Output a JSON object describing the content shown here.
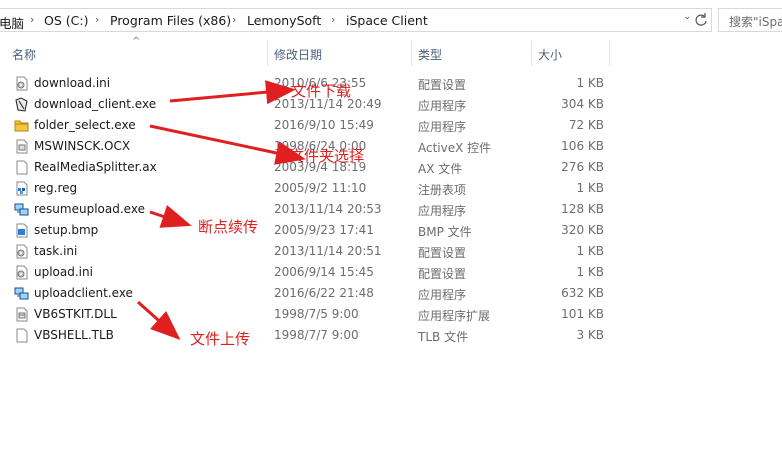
{
  "address": {
    "crumbs": [
      "电脑",
      "OS (C:)",
      "Program Files (x86)",
      "LemonySoft",
      "iSpace Client"
    ],
    "search_placeholder": "搜索\"iSpa"
  },
  "columns": {
    "name": "名称",
    "date": "修改日期",
    "type": "类型",
    "size": "大小"
  },
  "files": [
    {
      "name": "download.ini",
      "date": "2010/6/6 23:55",
      "type": "配置设置",
      "size": "1 KB",
      "icon": "ini-settings-icon"
    },
    {
      "name": "download_client.exe",
      "date": "2013/11/14 20:49",
      "type": "应用程序",
      "size": "304 KB",
      "icon": "app-exe-icon"
    },
    {
      "name": "folder_select.exe",
      "date": "2016/9/10 15:49",
      "type": "应用程序",
      "size": "72 KB",
      "icon": "folder-exe-icon"
    },
    {
      "name": "MSWINSCK.OCX",
      "date": "1998/6/24 0:00",
      "type": "ActiveX 控件",
      "size": "106 KB",
      "icon": "ocx-file-icon"
    },
    {
      "name": "RealMediaSplitter.ax",
      "date": "2003/9/4 18:19",
      "type": "AX 文件",
      "size": "276 KB",
      "icon": "blank-file-icon"
    },
    {
      "name": "reg.reg",
      "date": "2005/9/2 11:10",
      "type": "注册表项",
      "size": "1 KB",
      "icon": "registry-file-icon"
    },
    {
      "name": "resumeupload.exe",
      "date": "2013/11/14 20:53",
      "type": "应用程序",
      "size": "128 KB",
      "icon": "network-exe-icon"
    },
    {
      "name": "setup.bmp",
      "date": "2005/9/23 17:41",
      "type": "BMP 文件",
      "size": "320 KB",
      "icon": "bitmap-file-icon"
    },
    {
      "name": "task.ini",
      "date": "2013/11/14 20:51",
      "type": "配置设置",
      "size": "1 KB",
      "icon": "ini-settings-icon"
    },
    {
      "name": "upload.ini",
      "date": "2006/9/14 15:45",
      "type": "配置设置",
      "size": "1 KB",
      "icon": "ini-settings-icon"
    },
    {
      "name": "uploadclient.exe",
      "date": "2016/6/22 21:48",
      "type": "应用程序",
      "size": "632 KB",
      "icon": "network-exe-icon"
    },
    {
      "name": "VB6STKIT.DLL",
      "date": "1998/7/5 9:00",
      "type": "应用程序扩展",
      "size": "101 KB",
      "icon": "dll-file-icon"
    },
    {
      "name": "VBSHELL.TLB",
      "date": "1998/7/7 9:00",
      "type": "TLB 文件",
      "size": "3 KB",
      "icon": "blank-file-icon"
    }
  ],
  "annotations": {
    "download": "文件下载",
    "folder": "文件夹选择",
    "resume": "断点续传",
    "upload": "文件上传",
    "color": "#e02020"
  }
}
